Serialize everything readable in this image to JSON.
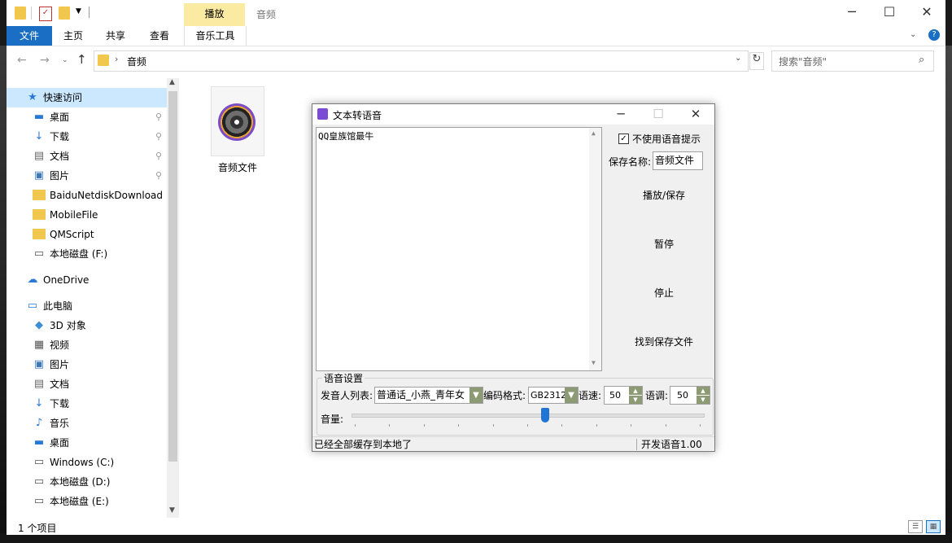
{
  "explorer": {
    "window_title": "音频",
    "context_tab": "播放",
    "ribbon_tabs": [
      "文件",
      "主页",
      "共享",
      "查看",
      "音乐工具"
    ],
    "address": "音频",
    "search_placeholder": "搜索\"音频\"",
    "nav": [
      {
        "label": "快速访问",
        "icon": "star-icon",
        "top": true,
        "selected": true
      },
      {
        "label": "桌面",
        "icon": "desktop-icon",
        "pinned": true
      },
      {
        "label": "下载",
        "icon": "download-arrow-icon",
        "pinned": true
      },
      {
        "label": "文档",
        "icon": "document-icon",
        "pinned": true
      },
      {
        "label": "图片",
        "icon": "picture-icon",
        "pinned": true
      },
      {
        "label": "BaiduNetdiskDownload",
        "icon": "folder-icon"
      },
      {
        "label": "MobileFile",
        "icon": "folder-icon"
      },
      {
        "label": "QMScript",
        "icon": "folder-icon"
      },
      {
        "label": "本地磁盘 (F:)",
        "icon": "drive-icon"
      },
      {
        "label": "OneDrive",
        "icon": "cloud-icon",
        "top": true
      },
      {
        "label": "此电脑",
        "icon": "computer-icon",
        "top": true
      },
      {
        "label": "3D 对象",
        "icon": "cube-icon"
      },
      {
        "label": "视频",
        "icon": "video-icon"
      },
      {
        "label": "图片",
        "icon": "picture-icon"
      },
      {
        "label": "文档",
        "icon": "document-icon"
      },
      {
        "label": "下载",
        "icon": "download-arrow-icon"
      },
      {
        "label": "音乐",
        "icon": "music-note-icon"
      },
      {
        "label": "桌面",
        "icon": "desktop-icon"
      },
      {
        "label": "Windows (C:)",
        "icon": "windows-drive-icon"
      },
      {
        "label": "本地磁盘 (D:)",
        "icon": "drive-icon"
      },
      {
        "label": "本地磁盘 (E:)",
        "icon": "drive-icon"
      }
    ],
    "file_name": "音频文件",
    "status": "1 个项目"
  },
  "dialog": {
    "title": "文本转语音",
    "text_content": "QQ皇族馆最牛",
    "no_voice_prompt_label": "不使用语音提示",
    "no_voice_prompt_checked": true,
    "save_name_label": "保存名称:",
    "save_name_value": "音频文件",
    "play_save_button": "播放/保存",
    "pause_button": "暂停",
    "stop_button": "停止",
    "find_file_button": "找到保存文件",
    "group_label": "语音设置",
    "speaker_label": "发音人列表:",
    "speaker_value": "普通话_小燕_青年女",
    "encoding_label": "编码格式:",
    "encoding_value": "GB2312",
    "speed_label": "语速:",
    "speed_value": "50",
    "pitch_label": "语调:",
    "pitch_value": "50",
    "volume_label": "音量:",
    "volume_level": 0.55,
    "status_left": "已经全部缓存到本地了",
    "status_right": "开发语音1.00"
  },
  "colors": {
    "accent": "#1a6fc4",
    "context_tab": "#fbeba2",
    "selection": "#cce8ff",
    "spin_button": "#8d9b74"
  }
}
